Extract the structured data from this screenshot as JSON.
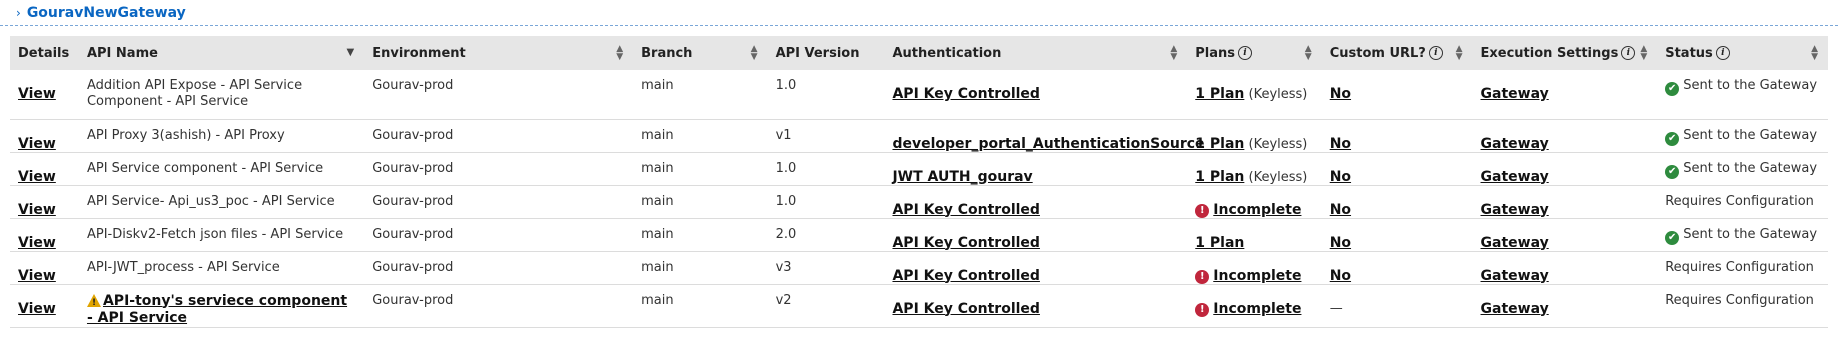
{
  "gateway": {
    "name": "GouravNewGateway"
  },
  "table": {
    "columns": {
      "details": "Details",
      "api_name": "API Name",
      "environment": "Environment",
      "branch": "Branch",
      "api_version": "API Version",
      "authentication": "Authentication",
      "plans": "Plans",
      "custom_url": "Custom URL?",
      "execution_settings": "Execution Settings",
      "status": "Status"
    },
    "rows": [
      {
        "details": "View",
        "api_name": "Addition API Expose - API Service Component - API Service",
        "environment": "Gourav-prod",
        "branch": "main",
        "api_version": "1.0",
        "authentication": "API Key Controlled",
        "plans": "1 Plan",
        "plans_note": "(Keyless)",
        "custom_url": "No",
        "execution": "Gateway",
        "status": "Sent to the Gateway"
      },
      {
        "details": "View",
        "api_name": "API Proxy 3(ashish) - API Proxy",
        "environment": "Gourav-prod",
        "branch": "main",
        "api_version": "v1",
        "authentication": "developer_portal_AuthenticationSource",
        "plans": "1 Plan",
        "plans_note": "(Keyless)",
        "custom_url": "No",
        "execution": "Gateway",
        "status": "Sent to the Gateway"
      },
      {
        "details": "View",
        "api_name": "API Service component - API Service",
        "environment": "Gourav-prod",
        "branch": "main",
        "api_version": "1.0",
        "authentication": "JWT AUTH_gourav",
        "plans": "1 Plan",
        "plans_note": "(Keyless)",
        "custom_url": "No",
        "execution": "Gateway",
        "status": "Sent to the Gateway"
      },
      {
        "details": "View",
        "api_name": "API Service- Api_us3_poc - API Service",
        "environment": "Gourav-prod",
        "branch": "main",
        "api_version": "1.0",
        "authentication": "API Key Controlled",
        "plans": "Incomplete",
        "custom_url": "No",
        "execution": "Gateway",
        "status": "Requires Configuration"
      },
      {
        "details": "View",
        "api_name": "API-Diskv2-Fetch json files - API Service",
        "environment": "Gourav-prod",
        "branch": "main",
        "api_version": "2.0",
        "authentication": "API Key Controlled",
        "plans": "1 Plan",
        "custom_url": "No",
        "execution": "Gateway",
        "status": "Sent to the Gateway"
      },
      {
        "details": "View",
        "api_name": "API-JWT_process - API Service",
        "environment": "Gourav-prod",
        "branch": "main",
        "api_version": "v3",
        "authentication": "API Key Controlled",
        "plans": "Incomplete",
        "custom_url": "No",
        "execution": "Gateway",
        "status": "Requires Configuration"
      },
      {
        "details": "View",
        "api_name": "API-tony's serviece component - API Service",
        "environment": "Gourav-prod",
        "branch": "main",
        "api_version": "v2",
        "authentication": "API Key Controlled",
        "plans": "Incomplete",
        "custom_url": "—",
        "execution": "Gateway",
        "status": "Requires Configuration"
      }
    ]
  },
  "icons": {
    "sent": "check-circle-icon",
    "incomplete": "error-circle-icon",
    "warning": "warning-triangle-icon",
    "info": "info-icon"
  },
  "colors": {
    "link": "#0a66c2",
    "success": "#2e8b3e",
    "error": "#c0263c",
    "warning": "#e0a400",
    "header_bg": "#e6e6e6"
  }
}
